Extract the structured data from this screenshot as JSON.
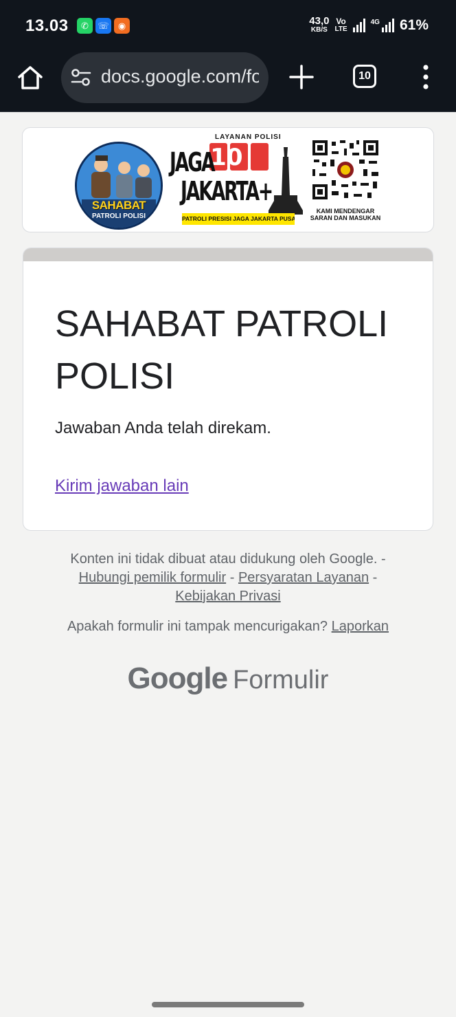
{
  "status_bar": {
    "time": "13.03",
    "net_speed_value": "43,0",
    "net_speed_unit": "KB/S",
    "volte_top": "Vo",
    "volte_bottom": "LTE",
    "network_4g": "4G",
    "battery": "61%",
    "apps": [
      {
        "name": "whatsapp-icon",
        "color": "#25d366"
      },
      {
        "name": "messenger-icon",
        "color": "#1877f2"
      },
      {
        "name": "app-icon",
        "color": "#f26d21"
      }
    ]
  },
  "browser": {
    "url": "docs.google.com/fo",
    "tab_count": "10"
  },
  "banner": {
    "logo_caption_main": "SAHABAT",
    "logo_caption_sub": "PATROLI POLISI",
    "service_label": "LAYANAN POLISI",
    "hotline_number": "110",
    "jaga": "JAGA",
    "jakarta": "JAKARTA+",
    "strip_text": "PATROLI PRESISI JAGA JAKARTA PUSAT",
    "qr_caption": "KAMI MENDENGAR SARAN DAN MASUKAN"
  },
  "form": {
    "title": "SAHABAT PATROLI POLISI",
    "confirmation": "Jawaban Anda telah direkam.",
    "another_response_link": "Kirim jawaban lain"
  },
  "footer": {
    "disclaimer": "Konten ini tidak dibuat atau didukung oleh Google. -",
    "contact_owner": "Hubungi pemilik formulir",
    "sep": "-",
    "terms": "Persyaratan Layanan",
    "privacy": "Kebijakan Privasi",
    "suspicious_question": "Apakah formulir ini tampak mencurigakan?",
    "report": "Laporkan",
    "brand_google": "Google",
    "brand_forms": "Formulir"
  },
  "colors": {
    "toolbar_bg": "#10151c",
    "link_purple": "#673ab7",
    "page_bg": "#f3f3f2"
  }
}
